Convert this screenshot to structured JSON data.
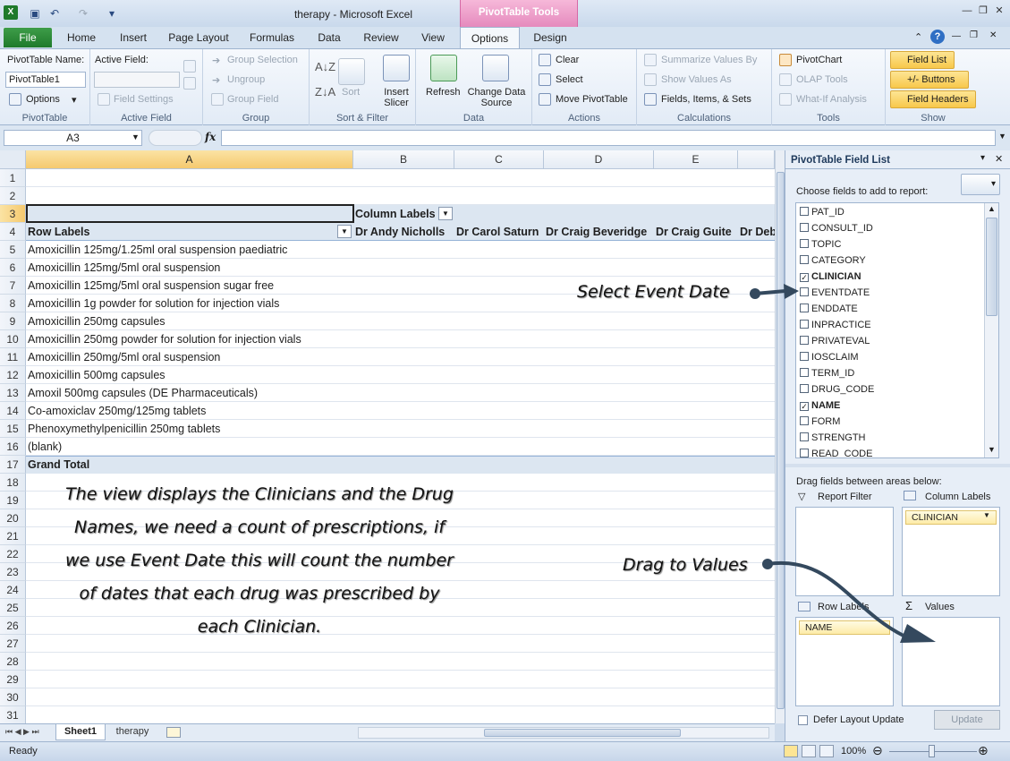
{
  "window": {
    "title": "therapy - Microsoft Excel",
    "context_tab": "PivotTable Tools"
  },
  "tabs": [
    "File",
    "Home",
    "Insert",
    "Page Layout",
    "Formulas",
    "Data",
    "Review",
    "View",
    "Options",
    "Design"
  ],
  "ribbon": {
    "pivottable": {
      "name_label": "PivotTable Name:",
      "name_value": "PivotTable1",
      "options": "Options",
      "group": "PivotTable"
    },
    "active_field": {
      "label": "Active Field:",
      "settings": "Field Settings",
      "group": "Active Field"
    },
    "group": {
      "group_selection": "Group Selection",
      "ungroup": "Ungroup",
      "group_field": "Group Field",
      "group": "Group"
    },
    "sort": {
      "sort": "Sort",
      "insert_slicer": "Insert Slicer",
      "group": "Sort & Filter"
    },
    "data": {
      "refresh": "Refresh",
      "change_source": "Change Data Source",
      "group": "Data"
    },
    "actions": {
      "clear": "Clear",
      "select": "Select",
      "move": "Move PivotTable",
      "group": "Actions"
    },
    "calculations": {
      "summarize": "Summarize Values By",
      "show_values": "Show Values As",
      "fields_items": "Fields, Items, & Sets",
      "group": "Calculations"
    },
    "tools": {
      "pivotchart": "PivotChart",
      "olap": "OLAP Tools",
      "whatif": "What-If Analysis",
      "group": "Tools"
    },
    "show": {
      "field_list": "Field List",
      "buttons": "+/- Buttons",
      "headers": "Field Headers",
      "group": "Show"
    }
  },
  "formula_bar": {
    "name_box": "A3",
    "fx": "fx"
  },
  "columns": [
    "A",
    "B",
    "C",
    "D",
    "E"
  ],
  "rows": [
    "1",
    "2",
    "3",
    "4",
    "5",
    "6",
    "7",
    "8",
    "9",
    "10",
    "11",
    "12",
    "13",
    "14",
    "15",
    "16",
    "17",
    "18",
    "19",
    "20",
    "21",
    "22",
    "23",
    "24",
    "25",
    "26",
    "27",
    "28",
    "29",
    "30",
    "31"
  ],
  "pivot": {
    "column_labels": "Column Labels",
    "row_labels": "Row Labels",
    "clinicians": [
      "Dr Andy Nicholls",
      "Dr Carol Saturn",
      "Dr Craig Beveridge",
      "Dr Craig Guite",
      "Dr Deb"
    ],
    "drugs": [
      "Amoxicillin 125mg/1.25ml oral suspension paediatric",
      "Amoxicillin 125mg/5ml oral suspension",
      "Amoxicillin 125mg/5ml oral suspension sugar free",
      "Amoxicillin 1g powder for solution for injection vials",
      "Amoxicillin 250mg capsules",
      "Amoxicillin 250mg powder for solution for injection vials",
      "Amoxicillin 250mg/5ml oral suspension",
      "Amoxicillin 500mg capsules",
      "Amoxil 500mg capsules (DE Pharmaceuticals)",
      "Co-amoxiclav 250mg/125mg tablets",
      "Phenoxymethylpenicillin 250mg tablets",
      "(blank)"
    ],
    "grand_total": "Grand Total"
  },
  "annotations": {
    "select_event": "Select Event Date",
    "drag_values": "Drag to Values",
    "note": [
      "The view displays the Clinicians and the Drug",
      "Names, we need a count of prescriptions, if",
      "we use Event Date this will count the number",
      "of dates that each drug was prescribed by",
      "each Clinician."
    ]
  },
  "sheets": [
    "Sheet1",
    "therapy"
  ],
  "status": {
    "ready": "Ready",
    "zoom": "100%"
  },
  "field_list": {
    "title": "PivotTable Field List",
    "choose": "Choose fields to add to report:",
    "fields": [
      {
        "name": "PAT_ID",
        "checked": false
      },
      {
        "name": "CONSULT_ID",
        "checked": false
      },
      {
        "name": "TOPIC",
        "checked": false
      },
      {
        "name": "CATEGORY",
        "checked": false
      },
      {
        "name": "CLINICIAN",
        "checked": true
      },
      {
        "name": "EVENTDATE",
        "checked": false
      },
      {
        "name": "ENDDATE",
        "checked": false
      },
      {
        "name": "INPRACTICE",
        "checked": false
      },
      {
        "name": "PRIVATEVAL",
        "checked": false
      },
      {
        "name": "IOSCLAIM",
        "checked": false
      },
      {
        "name": "TERM_ID",
        "checked": false
      },
      {
        "name": "DRUG_CODE",
        "checked": false
      },
      {
        "name": "NAME",
        "checked": true
      },
      {
        "name": "FORM",
        "checked": false
      },
      {
        "name": "STRENGTH",
        "checked": false
      },
      {
        "name": "READ_CODE",
        "checked": false
      }
    ],
    "drag_between": "Drag fields between areas below:",
    "report_filter": "Report Filter",
    "column_labels": "Column Labels",
    "row_labels": "Row Labels",
    "values": "Values",
    "column_chip": "CLINICIAN",
    "row_chip": "NAME",
    "defer": "Defer Layout Update",
    "update": "Update"
  }
}
